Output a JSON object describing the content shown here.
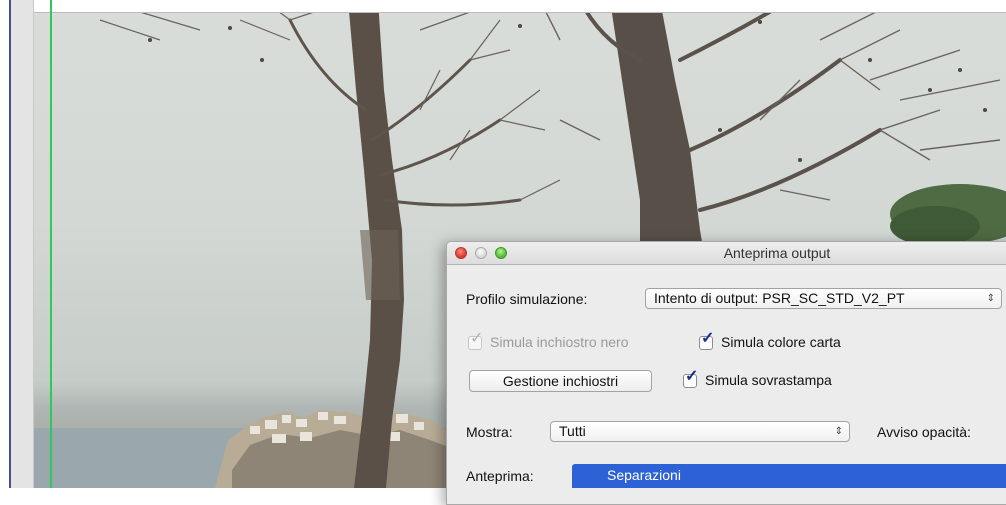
{
  "dialog": {
    "title": "Anteprima output",
    "simulation_profile": {
      "label": "Profilo simulazione:",
      "value": "Intento di output: PSR_SC_STD_V2_PT"
    },
    "simulate_black_ink": {
      "label": "Simula inchiostro nero",
      "checked": true,
      "enabled": false
    },
    "simulate_paper_color": {
      "label": "Simula colore carta",
      "checked": true,
      "enabled": true
    },
    "ink_manager_button": "Gestione inchiostri",
    "simulate_overprint": {
      "label": "Simula sovrastampa",
      "checked": true,
      "enabled": true
    },
    "show": {
      "label": "Mostra:",
      "value": "Tutti"
    },
    "opacity_warning_label": "Avviso opacità:",
    "preview": {
      "label": "Anteprima:",
      "selected_option": "Separazioni"
    }
  },
  "glyphs": {
    "check": "✓",
    "popup_arrows": "⌃⌄",
    "select_arrows": "⇕"
  },
  "colors": {
    "guide": "#2ec95a",
    "selection": "#2d62d6",
    "close_button": "#e0443a",
    "zoom_button": "#5fc43d"
  }
}
